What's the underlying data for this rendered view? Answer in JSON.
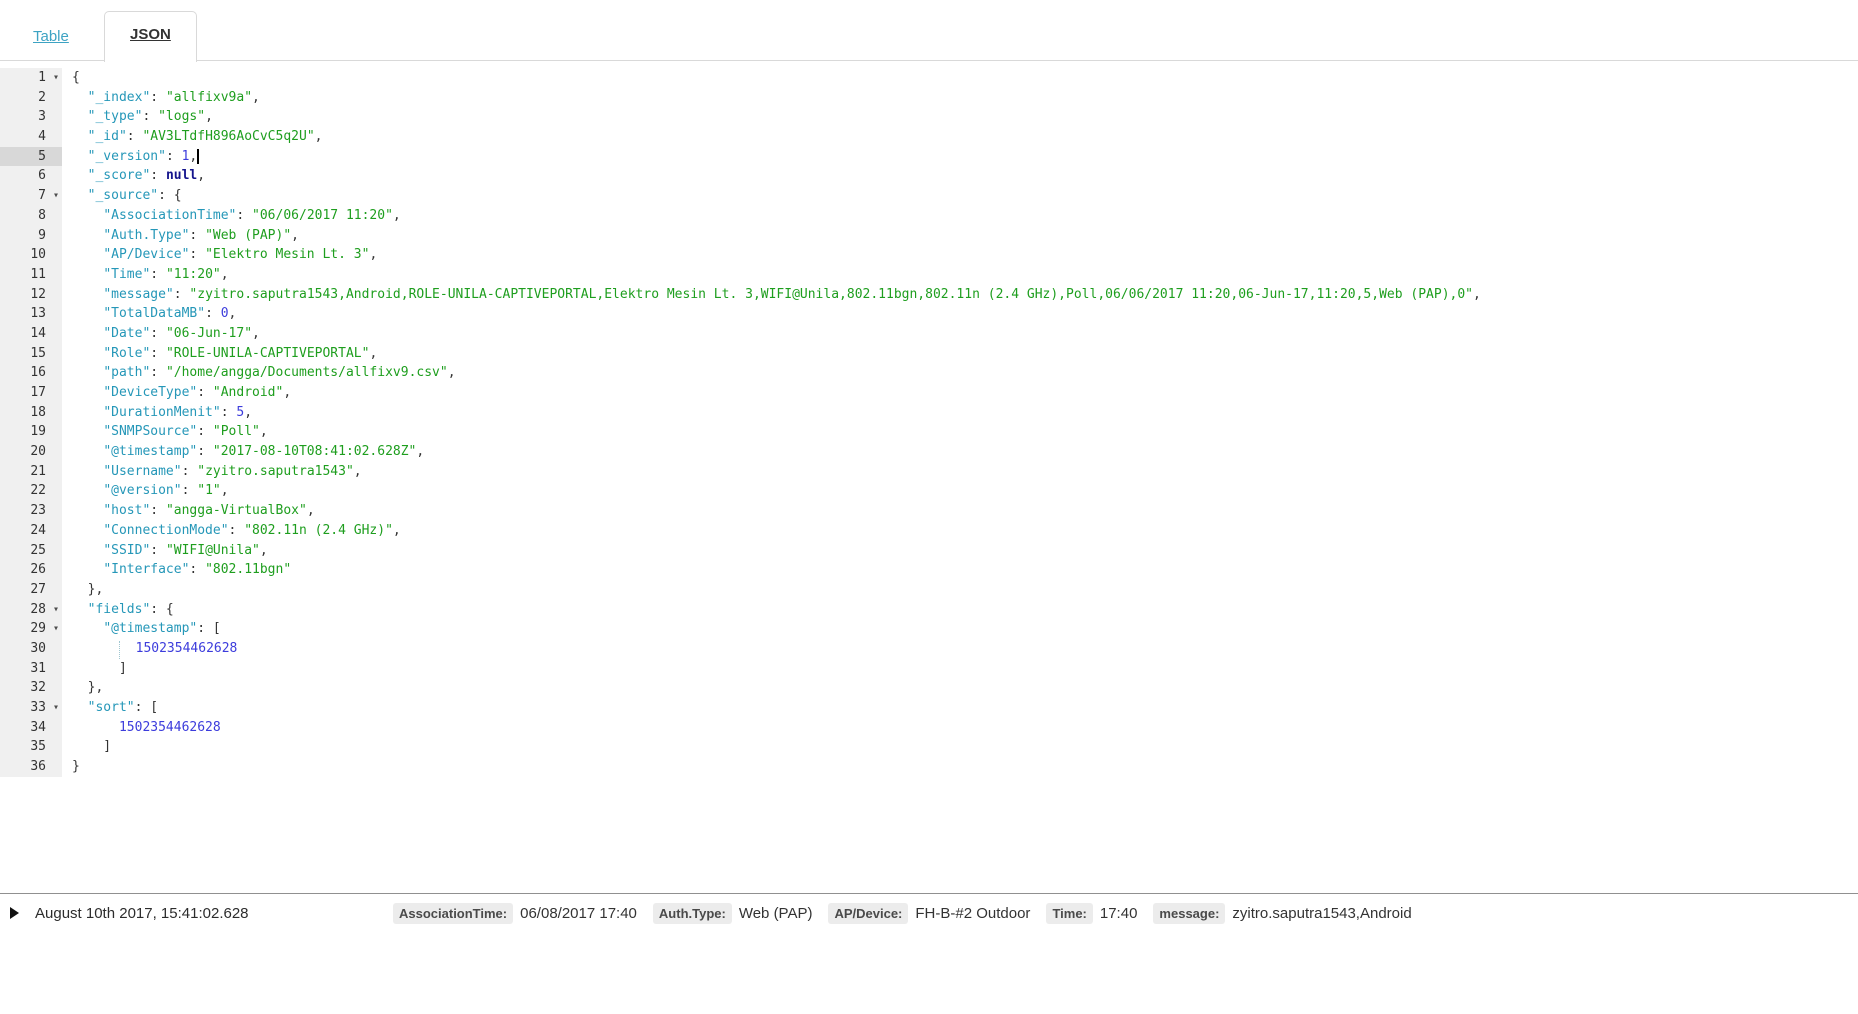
{
  "tabs": {
    "table_label": "Table",
    "json_label": "JSON",
    "active_tab": "JSON"
  },
  "colors": {
    "tab_link": "#3da3c3",
    "json_key": "#2597b8",
    "json_string": "#1e9e1e",
    "json_number": "#3c3cdc",
    "json_null": "#14148c",
    "gutter_bg": "#f0f0f0",
    "gutter_active_bg": "#d8d8d8"
  },
  "editor": {
    "lines": [
      {
        "n": 1,
        "fold": true,
        "segs": [
          [
            "p",
            "{"
          ]
        ]
      },
      {
        "n": 2,
        "segs": [
          [
            "p",
            "  "
          ],
          [
            "k",
            "\"_index\""
          ],
          [
            "p",
            ": "
          ],
          [
            "s",
            "\"allfixv9a\""
          ],
          [
            "p",
            ","
          ]
        ]
      },
      {
        "n": 3,
        "segs": [
          [
            "p",
            "  "
          ],
          [
            "k",
            "\"_type\""
          ],
          [
            "p",
            ": "
          ],
          [
            "s",
            "\"logs\""
          ],
          [
            "p",
            ","
          ]
        ]
      },
      {
        "n": 4,
        "segs": [
          [
            "p",
            "  "
          ],
          [
            "k",
            "\"_id\""
          ],
          [
            "p",
            ": "
          ],
          [
            "s",
            "\"AV3LTdfH896AoCvC5q2U\""
          ],
          [
            "p",
            ","
          ]
        ]
      },
      {
        "n": 5,
        "active": true,
        "cursor": true,
        "segs": [
          [
            "p",
            "  "
          ],
          [
            "k",
            "\"_version\""
          ],
          [
            "p",
            ": "
          ],
          [
            "n",
            "1"
          ],
          [
            "p",
            ","
          ]
        ]
      },
      {
        "n": 6,
        "segs": [
          [
            "p",
            "  "
          ],
          [
            "k",
            "\"_score\""
          ],
          [
            "p",
            ": "
          ],
          [
            "c",
            "null"
          ],
          [
            "p",
            ","
          ]
        ]
      },
      {
        "n": 7,
        "fold": true,
        "segs": [
          [
            "p",
            "  "
          ],
          [
            "k",
            "\"_source\""
          ],
          [
            "p",
            ": {"
          ]
        ]
      },
      {
        "n": 8,
        "segs": [
          [
            "p",
            "    "
          ],
          [
            "k",
            "\"AssociationTime\""
          ],
          [
            "p",
            ": "
          ],
          [
            "s",
            "\"06/06/2017 11:20\""
          ],
          [
            "p",
            ","
          ]
        ]
      },
      {
        "n": 9,
        "segs": [
          [
            "p",
            "    "
          ],
          [
            "k",
            "\"Auth.Type\""
          ],
          [
            "p",
            ": "
          ],
          [
            "s",
            "\"Web (PAP)\""
          ],
          [
            "p",
            ","
          ]
        ]
      },
      {
        "n": 10,
        "segs": [
          [
            "p",
            "    "
          ],
          [
            "k",
            "\"AP/Device\""
          ],
          [
            "p",
            ": "
          ],
          [
            "s",
            "\"Elektro Mesin Lt. 3\""
          ],
          [
            "p",
            ","
          ]
        ]
      },
      {
        "n": 11,
        "segs": [
          [
            "p",
            "    "
          ],
          [
            "k",
            "\"Time\""
          ],
          [
            "p",
            ": "
          ],
          [
            "s",
            "\"11:20\""
          ],
          [
            "p",
            ","
          ]
        ]
      },
      {
        "n": 12,
        "segs": [
          [
            "p",
            "    "
          ],
          [
            "k",
            "\"message\""
          ],
          [
            "p",
            ": "
          ],
          [
            "s",
            "\"zyitro.saputra1543,Android,ROLE-UNILA-CAPTIVEPORTAL,Elektro Mesin Lt. 3,WIFI@Unila,802.11bgn,802.11n (2.4 GHz),Poll,06/06/2017 11:20,06-Jun-17,11:20,5,Web (PAP),0\""
          ],
          [
            "p",
            ","
          ]
        ]
      },
      {
        "n": 13,
        "segs": [
          [
            "p",
            "    "
          ],
          [
            "k",
            "\"TotalDataMB\""
          ],
          [
            "p",
            ": "
          ],
          [
            "n",
            "0"
          ],
          [
            "p",
            ","
          ]
        ]
      },
      {
        "n": 14,
        "segs": [
          [
            "p",
            "    "
          ],
          [
            "k",
            "\"Date\""
          ],
          [
            "p",
            ": "
          ],
          [
            "s",
            "\"06-Jun-17\""
          ],
          [
            "p",
            ","
          ]
        ]
      },
      {
        "n": 15,
        "segs": [
          [
            "p",
            "    "
          ],
          [
            "k",
            "\"Role\""
          ],
          [
            "p",
            ": "
          ],
          [
            "s",
            "\"ROLE-UNILA-CAPTIVEPORTAL\""
          ],
          [
            "p",
            ","
          ]
        ]
      },
      {
        "n": 16,
        "segs": [
          [
            "p",
            "    "
          ],
          [
            "k",
            "\"path\""
          ],
          [
            "p",
            ": "
          ],
          [
            "s",
            "\"/home/angga/Documents/allfixv9.csv\""
          ],
          [
            "p",
            ","
          ]
        ]
      },
      {
        "n": 17,
        "segs": [
          [
            "p",
            "    "
          ],
          [
            "k",
            "\"DeviceType\""
          ],
          [
            "p",
            ": "
          ],
          [
            "s",
            "\"Android\""
          ],
          [
            "p",
            ","
          ]
        ]
      },
      {
        "n": 18,
        "segs": [
          [
            "p",
            "    "
          ],
          [
            "k",
            "\"DurationMenit\""
          ],
          [
            "p",
            ": "
          ],
          [
            "n",
            "5"
          ],
          [
            "p",
            ","
          ]
        ]
      },
      {
        "n": 19,
        "segs": [
          [
            "p",
            "    "
          ],
          [
            "k",
            "\"SNMPSource\""
          ],
          [
            "p",
            ": "
          ],
          [
            "s",
            "\"Poll\""
          ],
          [
            "p",
            ","
          ]
        ]
      },
      {
        "n": 20,
        "segs": [
          [
            "p",
            "    "
          ],
          [
            "k",
            "\"@timestamp\""
          ],
          [
            "p",
            ": "
          ],
          [
            "s",
            "\"2017-08-10T08:41:02.628Z\""
          ],
          [
            "p",
            ","
          ]
        ]
      },
      {
        "n": 21,
        "segs": [
          [
            "p",
            "    "
          ],
          [
            "k",
            "\"Username\""
          ],
          [
            "p",
            ": "
          ],
          [
            "s",
            "\"zyitro.saputra1543\""
          ],
          [
            "p",
            ","
          ]
        ]
      },
      {
        "n": 22,
        "segs": [
          [
            "p",
            "    "
          ],
          [
            "k",
            "\"@version\""
          ],
          [
            "p",
            ": "
          ],
          [
            "s",
            "\"1\""
          ],
          [
            "p",
            ","
          ]
        ]
      },
      {
        "n": 23,
        "segs": [
          [
            "p",
            "    "
          ],
          [
            "k",
            "\"host\""
          ],
          [
            "p",
            ": "
          ],
          [
            "s",
            "\"angga-VirtualBox\""
          ],
          [
            "p",
            ","
          ]
        ]
      },
      {
        "n": 24,
        "segs": [
          [
            "p",
            "    "
          ],
          [
            "k",
            "\"ConnectionMode\""
          ],
          [
            "p",
            ": "
          ],
          [
            "s",
            "\"802.11n (2.4 GHz)\""
          ],
          [
            "p",
            ","
          ]
        ]
      },
      {
        "n": 25,
        "segs": [
          [
            "p",
            "    "
          ],
          [
            "k",
            "\"SSID\""
          ],
          [
            "p",
            ": "
          ],
          [
            "s",
            "\"WIFI@Unila\""
          ],
          [
            "p",
            ","
          ]
        ]
      },
      {
        "n": 26,
        "segs": [
          [
            "p",
            "    "
          ],
          [
            "k",
            "\"Interface\""
          ],
          [
            "p",
            ": "
          ],
          [
            "s",
            "\"802.11bgn\""
          ]
        ]
      },
      {
        "n": 27,
        "segs": [
          [
            "p",
            "  },"
          ]
        ]
      },
      {
        "n": 28,
        "fold": true,
        "segs": [
          [
            "p",
            "  "
          ],
          [
            "k",
            "\"fields\""
          ],
          [
            "p",
            ": {"
          ]
        ]
      },
      {
        "n": 29,
        "fold": true,
        "segs": [
          [
            "p",
            "    "
          ],
          [
            "k",
            "\"@timestamp\""
          ],
          [
            "p",
            ": ["
          ]
        ]
      },
      {
        "n": 30,
        "segs": [
          [
            "p",
            "      "
          ],
          [
            "g",
            ""
          ],
          [
            "p",
            "  "
          ],
          [
            "n",
            "1502354462628"
          ]
        ]
      },
      {
        "n": 31,
        "segs": [
          [
            "p",
            "      ]"
          ]
        ]
      },
      {
        "n": 32,
        "segs": [
          [
            "p",
            "  },"
          ]
        ]
      },
      {
        "n": 33,
        "fold": true,
        "segs": [
          [
            "p",
            "  "
          ],
          [
            "k",
            "\"sort\""
          ],
          [
            "p",
            ": ["
          ]
        ]
      },
      {
        "n": 34,
        "segs": [
          [
            "p",
            "      "
          ],
          [
            "n",
            "1502354462628"
          ]
        ]
      },
      {
        "n": 35,
        "segs": [
          [
            "p",
            "    ]"
          ]
        ]
      },
      {
        "n": 36,
        "segs": [
          [
            "p",
            "}"
          ]
        ]
      }
    ]
  },
  "bottom_row": {
    "time": "August 10th 2017, 15:41:02.628",
    "fields": [
      {
        "label": "AssociationTime",
        "value": "06/08/2017 17:40"
      },
      {
        "label": "Auth.Type",
        "value": "Web (PAP)"
      },
      {
        "label": "AP/Device",
        "value": "FH-B-#2 Outdoor"
      },
      {
        "label": "Time",
        "value": "17:40"
      },
      {
        "label": "message",
        "value": "zyitro.saputra1543,Android"
      }
    ]
  }
}
